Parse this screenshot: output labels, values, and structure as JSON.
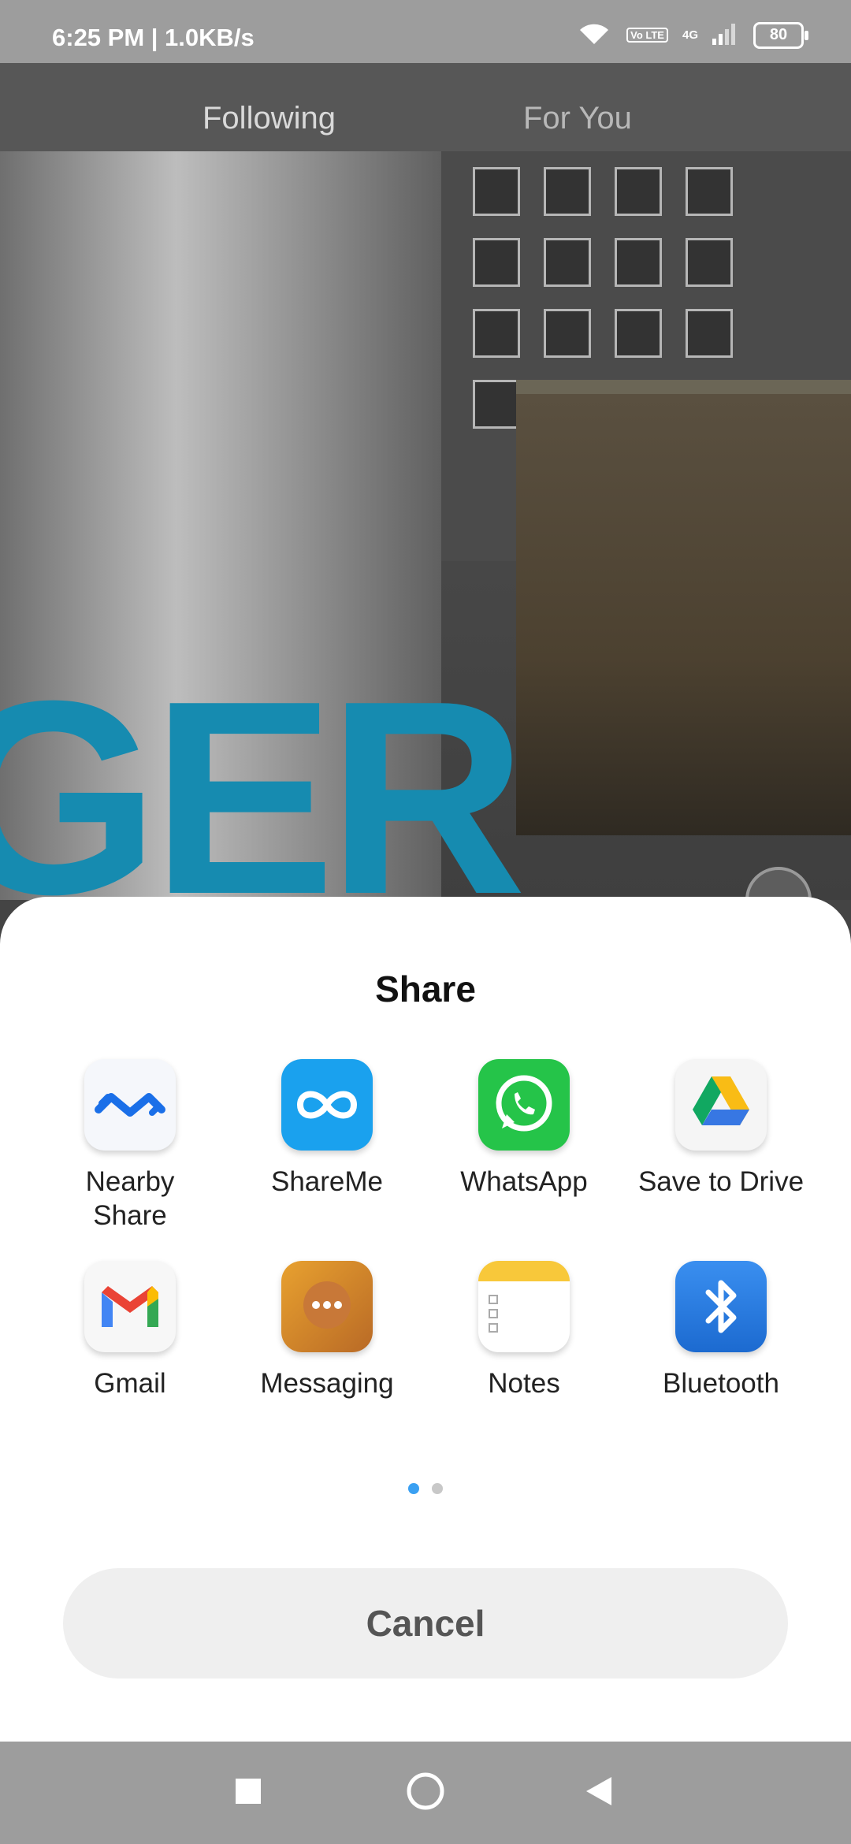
{
  "status_bar": {
    "time": "6:25 PM | 1.0KB/s",
    "volte": "Vo LTE",
    "network": "4G",
    "battery": "80"
  },
  "feed_tabs": [
    {
      "label": "Following"
    },
    {
      "label": "For You"
    }
  ],
  "video": {
    "overlay_text": "GER"
  },
  "share_sheet": {
    "title": "Share",
    "apps": [
      {
        "label_line1": "Nearby",
        "label_line2": "Share",
        "icon": "nearby-share-icon"
      },
      {
        "label_line1": "ShareMe",
        "label_line2": "",
        "icon": "shareme-icon"
      },
      {
        "label_line1": "WhatsApp",
        "label_line2": "",
        "icon": "whatsapp-icon"
      },
      {
        "label_line1": "Save to Drive",
        "label_line2": "",
        "icon": "google-drive-icon"
      },
      {
        "label_line1": "Gmail",
        "label_line2": "",
        "icon": "gmail-icon"
      },
      {
        "label_line1": "Messaging",
        "label_line2": "",
        "icon": "messaging-icon"
      },
      {
        "label_line1": "Notes",
        "label_line2": "",
        "icon": "notes-icon"
      },
      {
        "label_line1": "Bluetooth",
        "label_line2": "",
        "icon": "bluetooth-icon"
      }
    ],
    "page_indicator": {
      "pages": 2,
      "current": 1
    },
    "cancel_label": "Cancel"
  },
  "nav_bar": {
    "buttons": [
      "recents-icon",
      "home-icon",
      "back-icon"
    ]
  },
  "colors": {
    "accent_dot": "#3aa0f2",
    "overlay_text": "#168bb0"
  }
}
